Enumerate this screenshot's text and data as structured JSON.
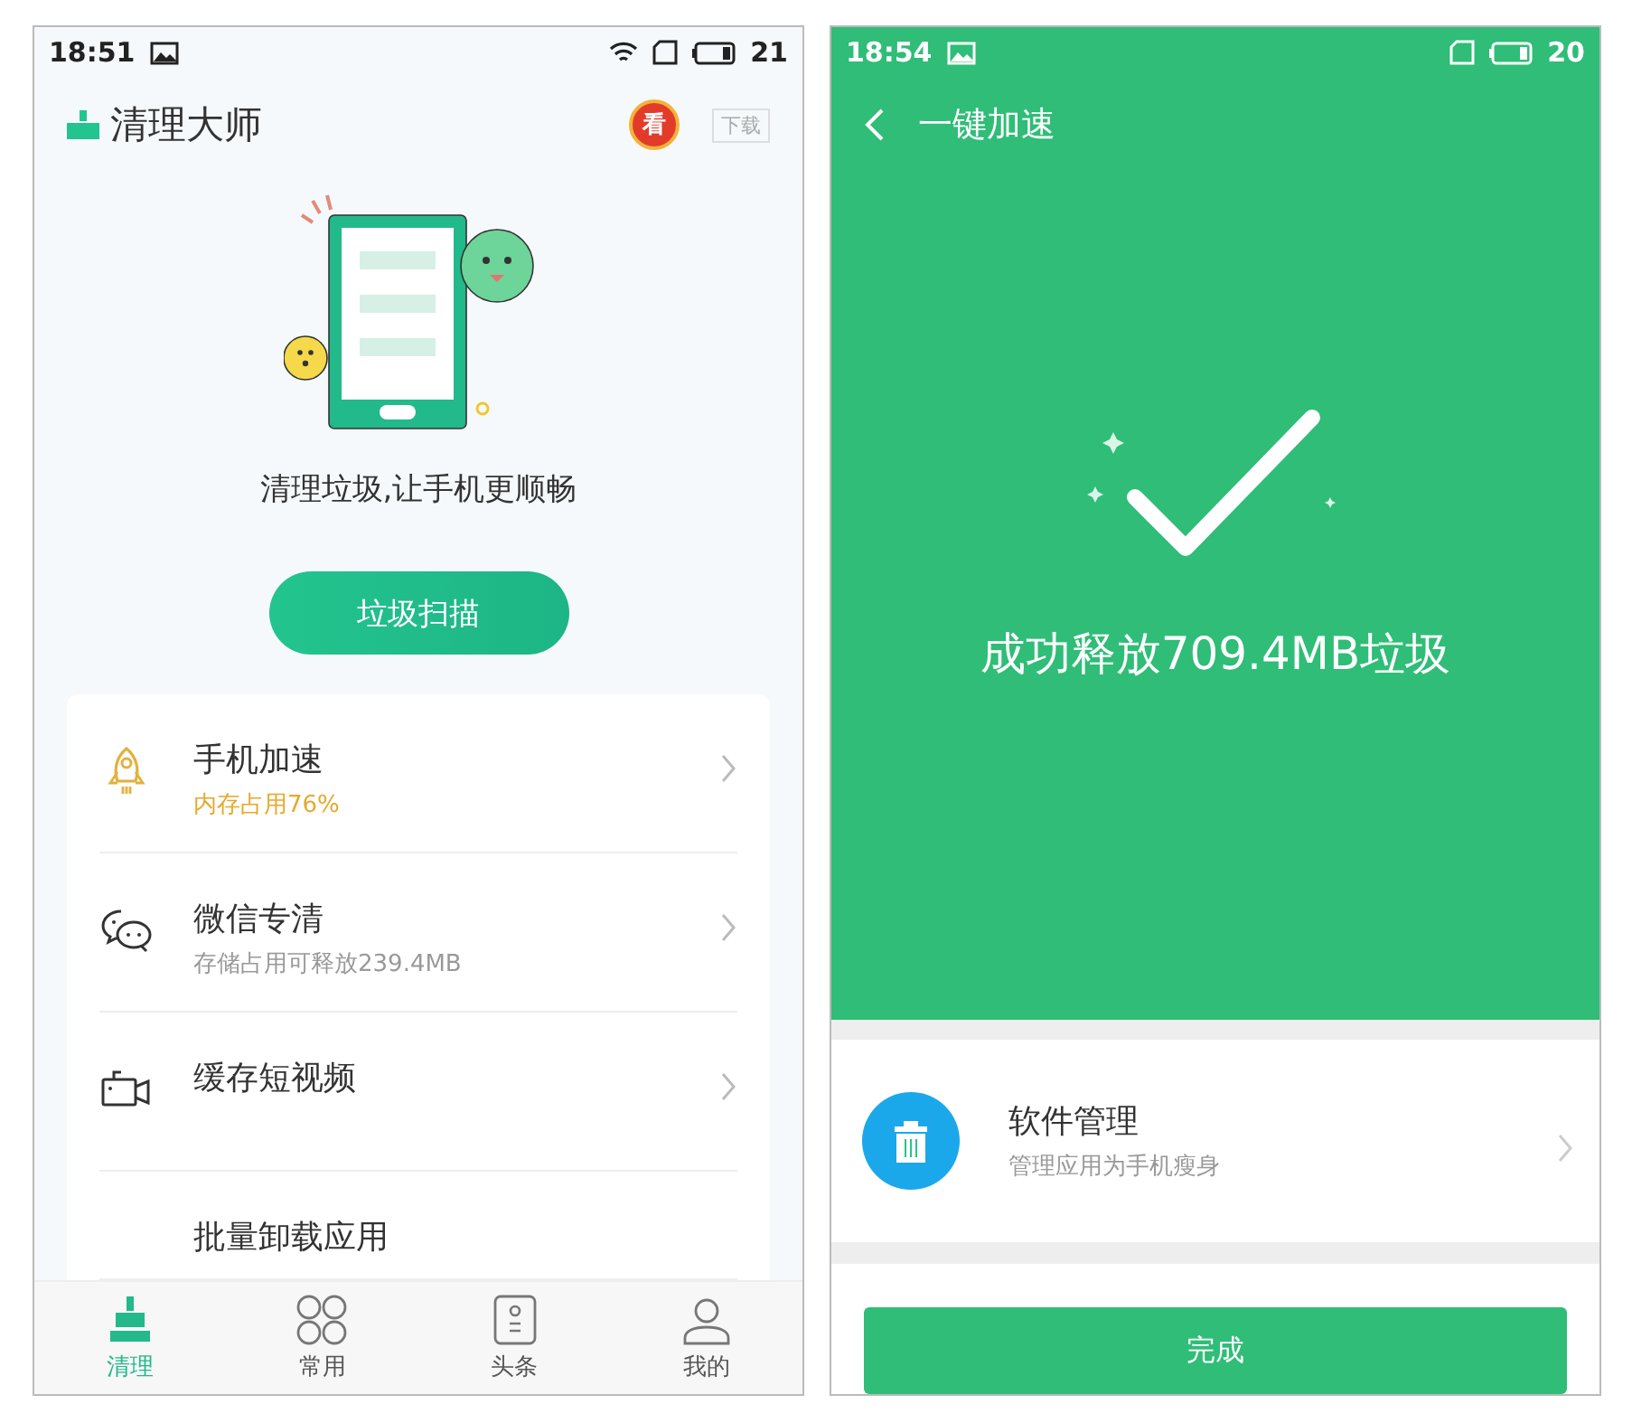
{
  "left_screen": {
    "status_bar": {
      "time": "18:51",
      "battery": "21"
    },
    "app_title": "清理大师",
    "ad_badge": "看",
    "download_label": "下载",
    "tagline": "清理垃圾,让手机更顺畅",
    "scan_button": "垃圾扫描",
    "features": [
      {
        "kind": "boost",
        "title": "手机加速",
        "subtitle": "内存占用76%",
        "warning": true
      },
      {
        "kind": "wechat",
        "title": "微信专清",
        "subtitle": "存储占用可释放239.4MB",
        "warning": false
      },
      {
        "kind": "video",
        "title": "缓存短视频"
      },
      {
        "kind": "uninstall",
        "title": "批量卸载应用"
      }
    ],
    "nav": [
      {
        "kind": "clean",
        "label": "清理",
        "selected": true
      },
      {
        "kind": "apps",
        "label": "常用",
        "selected": false
      },
      {
        "kind": "news",
        "label": "头条",
        "selected": false
      },
      {
        "kind": "profile",
        "label": "我的",
        "selected": false
      }
    ]
  },
  "right_screen": {
    "status_bar": {
      "time": "18:54",
      "battery": "20"
    },
    "title": "一键加速",
    "result": "成功释放709.4MB垃圾",
    "suggestion": {
      "title": "软件管理",
      "subtitle": "管理应用为手机瘦身"
    },
    "done_button": "完成"
  }
}
